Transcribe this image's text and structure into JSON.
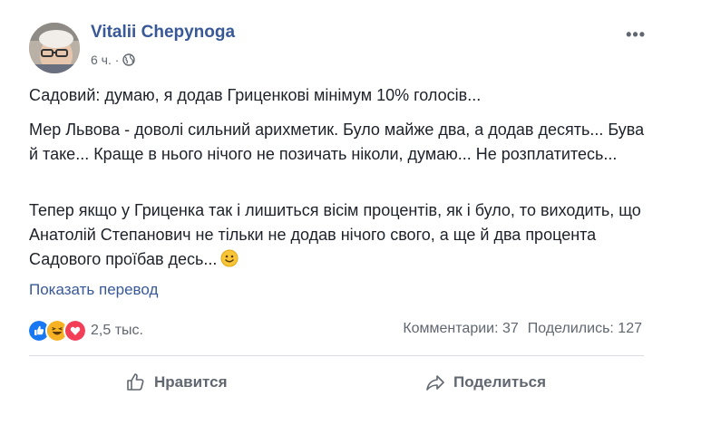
{
  "post": {
    "author": "Vitalii Chepynoga",
    "time": "6 ч. ·",
    "paragraphs": [
      "Садовий: думаю, я додав Гриценкові мінімум 10% голосів...",
      "Мер Львова - доволі сильний арихметик. Було майже два, а додав десять... Бува й таке... Краще в нього нічого не позичать ніколи, думаю... Не розплатитесь...",
      "Тепер якщо у Гриценка так і лишиться вісім процентів, як і було, то виходить, що Анатолій Степанович не тільки не додав нічого свого, а ще й два процента Садового проїбав десь..."
    ],
    "translate_link": "Показать перевод",
    "reactions_count": "2,5 тыс.",
    "comments": "Комментарии: 37",
    "shares": "Поделились: 127"
  },
  "actions": {
    "like": "Нравится",
    "share": "Поделиться"
  },
  "colors": {
    "link": "#385898",
    "secondary": "#606770",
    "like_blue": "#1877f2",
    "haha_yellow": "#f7b125",
    "love_red": "#f33e58"
  }
}
